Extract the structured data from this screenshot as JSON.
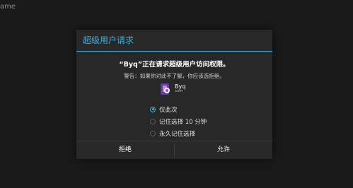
{
  "background": {
    "title_fragment": "ame"
  },
  "dialog": {
    "title": "超级用户请求",
    "message": "“Byq”正在请求超级用户访问权限。",
    "warning": "警告：如果你对此不了解，你应该选拒绝。",
    "app": {
      "name": "Byq",
      "sub": ".com",
      "icon": "app-icon"
    },
    "options": [
      {
        "label": "仅此次",
        "checked": true
      },
      {
        "label": "记住选择 10 分钟",
        "checked": false
      },
      {
        "label": "永久记住选择",
        "checked": false
      }
    ],
    "buttons": {
      "deny": "拒绝",
      "allow": "允许"
    }
  },
  "colors": {
    "accent": "#34b5e5",
    "dialog_bg": "#282828",
    "page_bg": "#1a1a1a"
  }
}
